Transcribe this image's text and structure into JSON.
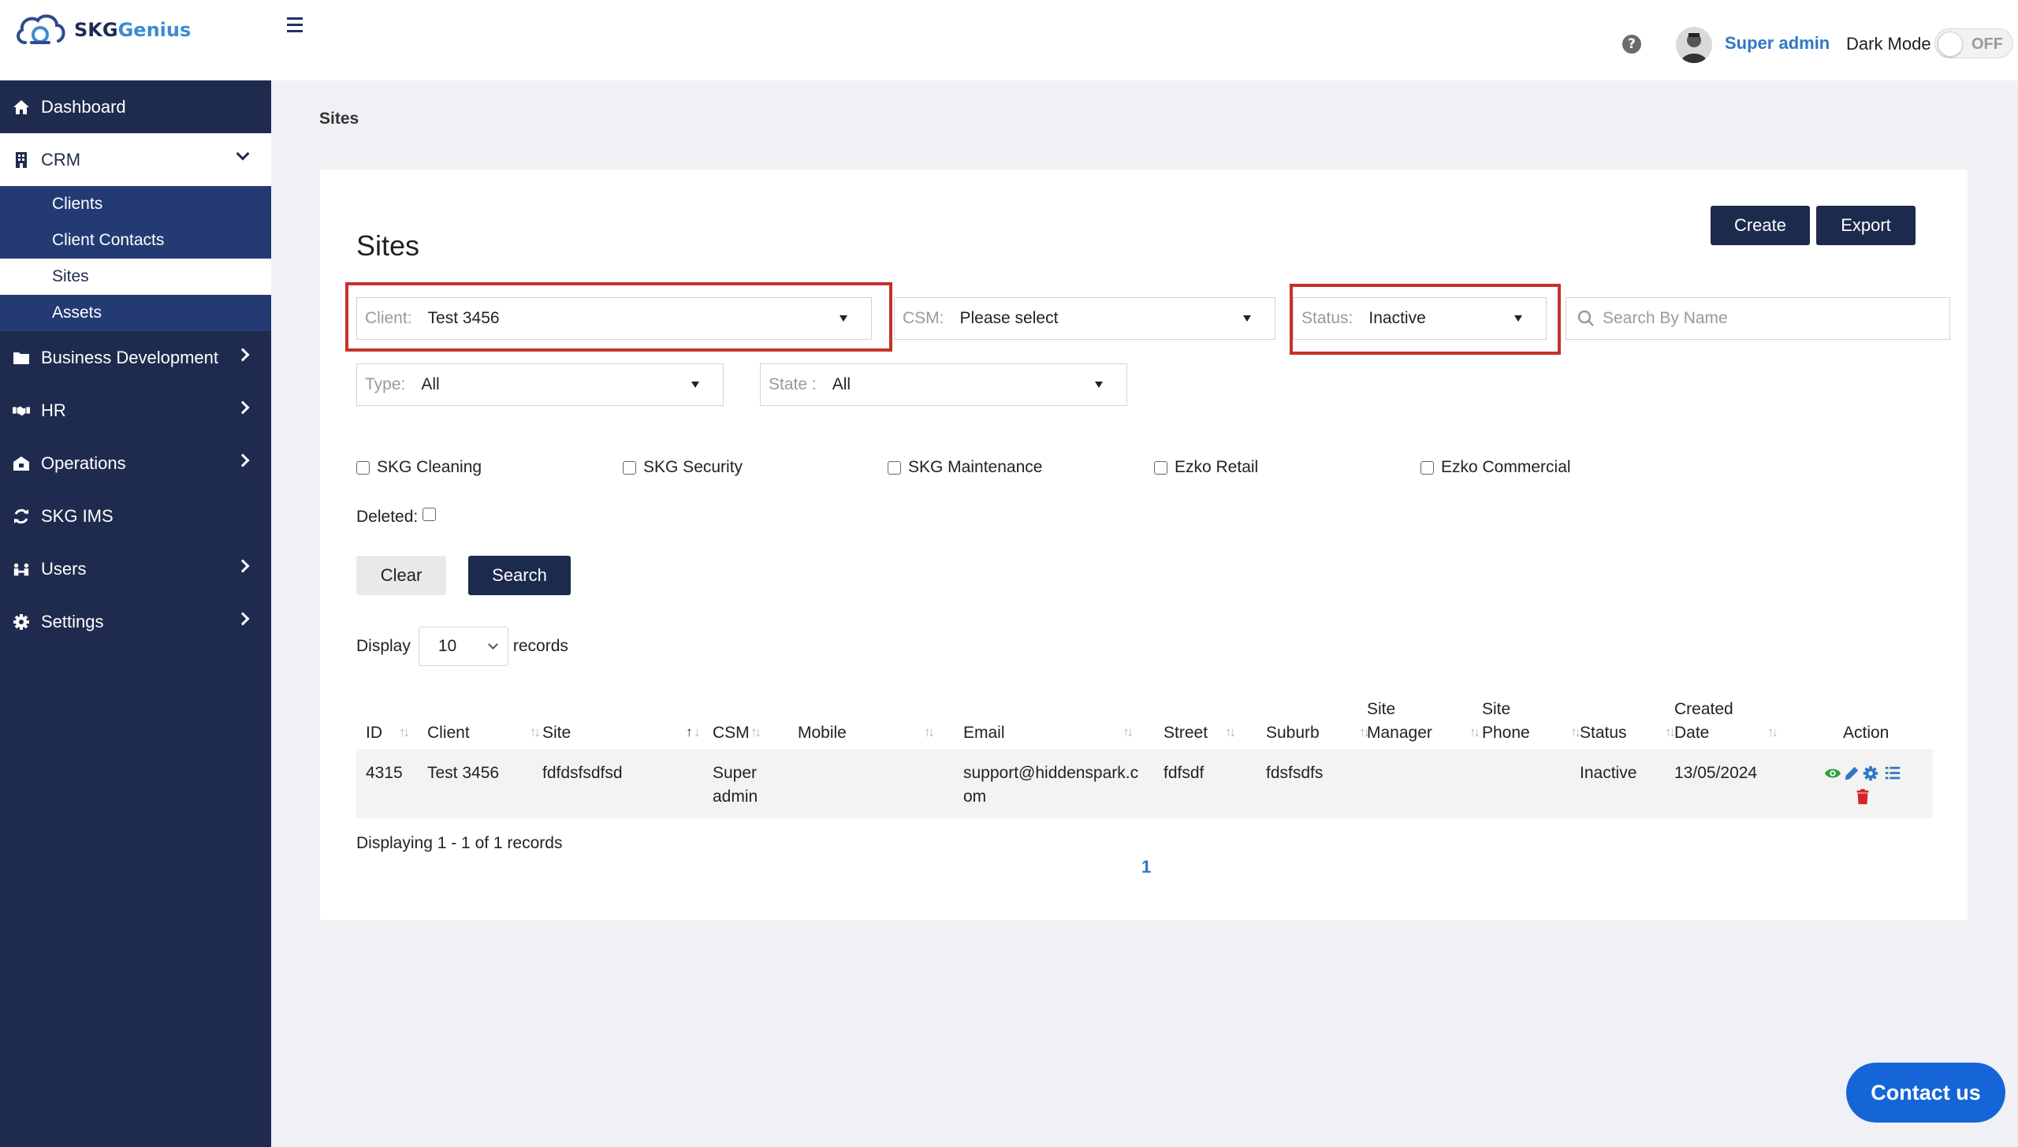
{
  "brand": {
    "name_part1": "SKG",
    "name_part2": "enius"
  },
  "header": {
    "user_name": "Super admin",
    "dark_mode_label": "Dark Mode",
    "toggle_state": "OFF"
  },
  "sidebar": {
    "items": [
      {
        "label": "Dashboard",
        "icon": "home-icon"
      },
      {
        "label": "CRM",
        "icon": "building-icon"
      },
      {
        "label": "Business Development",
        "icon": "folder-icon"
      },
      {
        "label": "HR",
        "icon": "handshake-icon"
      },
      {
        "label": "Operations",
        "icon": "briefcase-icon"
      },
      {
        "label": "SKG IMS",
        "icon": "sync-icon"
      },
      {
        "label": "Users",
        "icon": "users-icon"
      },
      {
        "label": "Settings",
        "icon": "gear-icon"
      }
    ],
    "crm_sub": [
      "Clients",
      "Client Contacts",
      "Sites",
      "Assets"
    ]
  },
  "breadcrumb": "Sites",
  "page": {
    "title": "Sites",
    "create_label": "Create",
    "export_label": "Export"
  },
  "filters": {
    "client": {
      "label": "Client:",
      "value": "Test 3456"
    },
    "csm": {
      "label": "CSM:",
      "value": "Please select"
    },
    "status": {
      "label": "Status:",
      "value": "Inactive"
    },
    "search_placeholder": "Search By Name",
    "type": {
      "label": "Type:",
      "value": "All"
    },
    "state": {
      "label": "State :",
      "value": "All"
    },
    "checkboxes": [
      "SKG Cleaning",
      "SKG Security",
      "SKG Maintenance",
      "Ezko Retail",
      "Ezko Commercial"
    ],
    "deleted_label": "Deleted:",
    "clear_label": "Clear",
    "search_label": "Search"
  },
  "display": {
    "prefix": "Display",
    "value": "10",
    "suffix": "records"
  },
  "table": {
    "headers": {
      "id": "ID",
      "client": "Client",
      "site": "Site",
      "csm": "CSM",
      "mobile": "Mobile",
      "email": "Email",
      "street": "Street",
      "suburb": "Suburb",
      "site_manager_1": "Site",
      "site_manager_2": "Manager",
      "site_phone_1": "Site",
      "site_phone_2": "Phone",
      "status": "Status",
      "created_1": "Created",
      "created_2": "Date",
      "action": "Action"
    },
    "row": {
      "id": "4315",
      "client": "Test 3456",
      "site": "fdfdsfsdfsd",
      "csm_1": "Super",
      "csm_2": "admin",
      "mobile": "",
      "email_1": "support@hiddenspark.c",
      "email_2": "om",
      "street": "fdfsdf",
      "suburb": "fdsfsdfs",
      "site_manager": "",
      "site_phone": "",
      "status": "Inactive",
      "created": "13/05/2024"
    },
    "footer": "Displaying 1 - 1 of 1 records",
    "page": "1"
  },
  "contact_label": "Contact us",
  "colors": {
    "sidebar": "#1f2b4e",
    "submenu": "#243a73",
    "primary": "#1c2a4d",
    "link": "#2f78c4",
    "highlight": "#c5312b",
    "contact": "#1565d8"
  }
}
